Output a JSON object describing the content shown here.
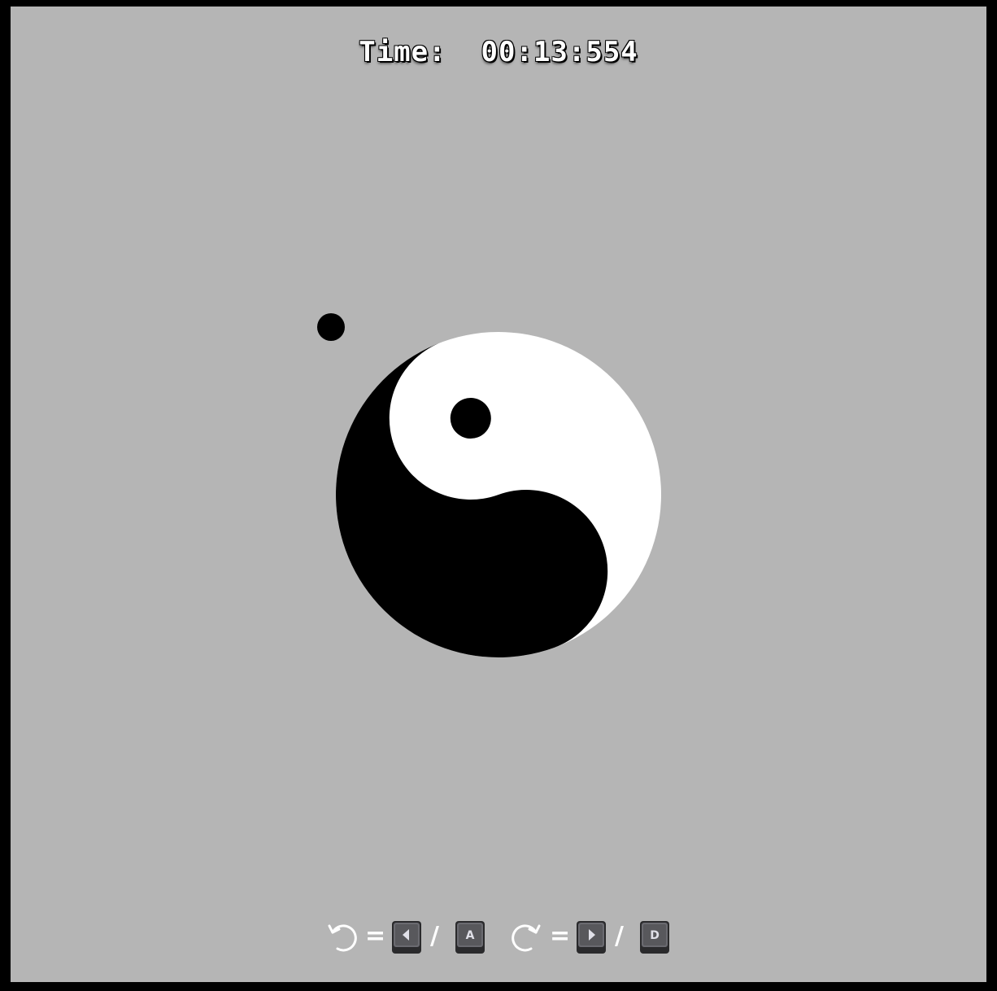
{
  "hud": {
    "timer_label": "Time:",
    "timer_value": "00:13:554"
  },
  "colors": {
    "background": "#b5b5b5",
    "border": "#000000",
    "yin": "#000000",
    "yang": "#ffffff",
    "key_face": "#555558",
    "key_glyph": "#d8d8e0"
  },
  "controls": {
    "rotate_left": {
      "icon": "rotate-counterclockwise-icon",
      "equals": "=",
      "separator": "/",
      "keys": [
        "left-arrow-key-icon",
        "a-key-icon"
      ],
      "key_glyphs": [
        "",
        "A"
      ]
    },
    "rotate_right": {
      "icon": "rotate-clockwise-icon",
      "equals": "=",
      "separator": "/",
      "keys": [
        "right-arrow-key-icon",
        "d-key-icon"
      ],
      "key_glyphs": [
        "",
        "D"
      ]
    }
  }
}
